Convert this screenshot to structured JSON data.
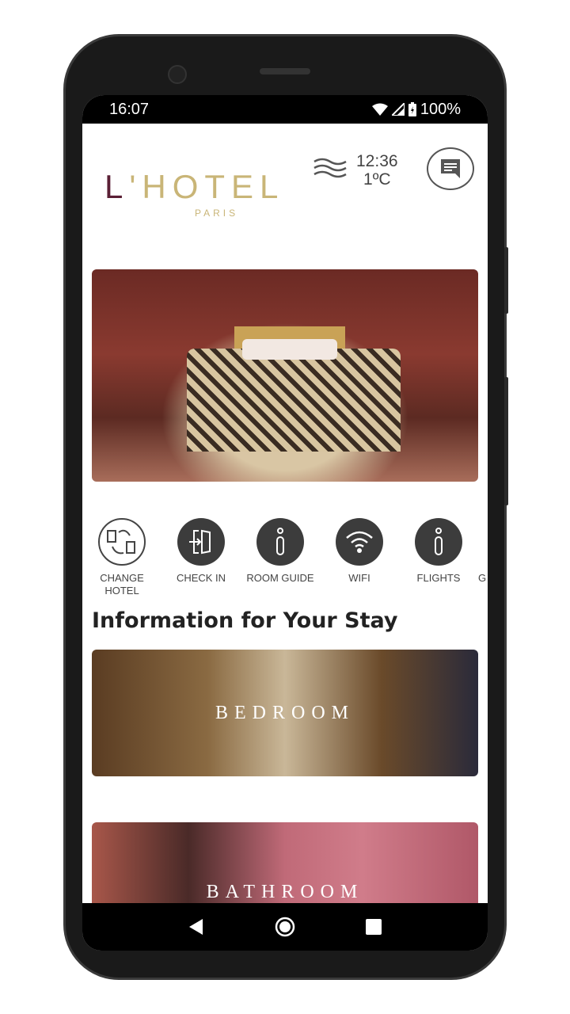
{
  "status_bar": {
    "time": "16:07",
    "battery": "100%",
    "icons": [
      "wifi-icon",
      "signal-icon",
      "battery-charging-icon"
    ]
  },
  "header": {
    "logo_main_l": "L",
    "logo_main_rest": "'HOTEL",
    "logo_sub": "PARIS",
    "weather_time": "12:36",
    "weather_temp": "1ºC",
    "weather_icon": "wind-icon",
    "chat_icon": "chat-icon"
  },
  "quick_actions": [
    {
      "label": "CHANGE HOTEL",
      "icon": "change-hotel-icon"
    },
    {
      "label": "CHECK IN",
      "icon": "check-in-door-icon"
    },
    {
      "label": "ROOM GUIDE",
      "icon": "info-icon"
    },
    {
      "label": "WIFI",
      "icon": "wifi-icon"
    },
    {
      "label": "FLIGHTS",
      "icon": "info-icon"
    },
    {
      "label": "G",
      "icon": ""
    }
  ],
  "section_title": "Information for Your Stay",
  "cards": [
    {
      "label": "BEDROOM"
    },
    {
      "label": "BATHROOM"
    }
  ],
  "colors": {
    "logo_gold": "#c9b577",
    "logo_burgundy": "#5a1f35",
    "icon_dark": "#3c3c3c"
  }
}
